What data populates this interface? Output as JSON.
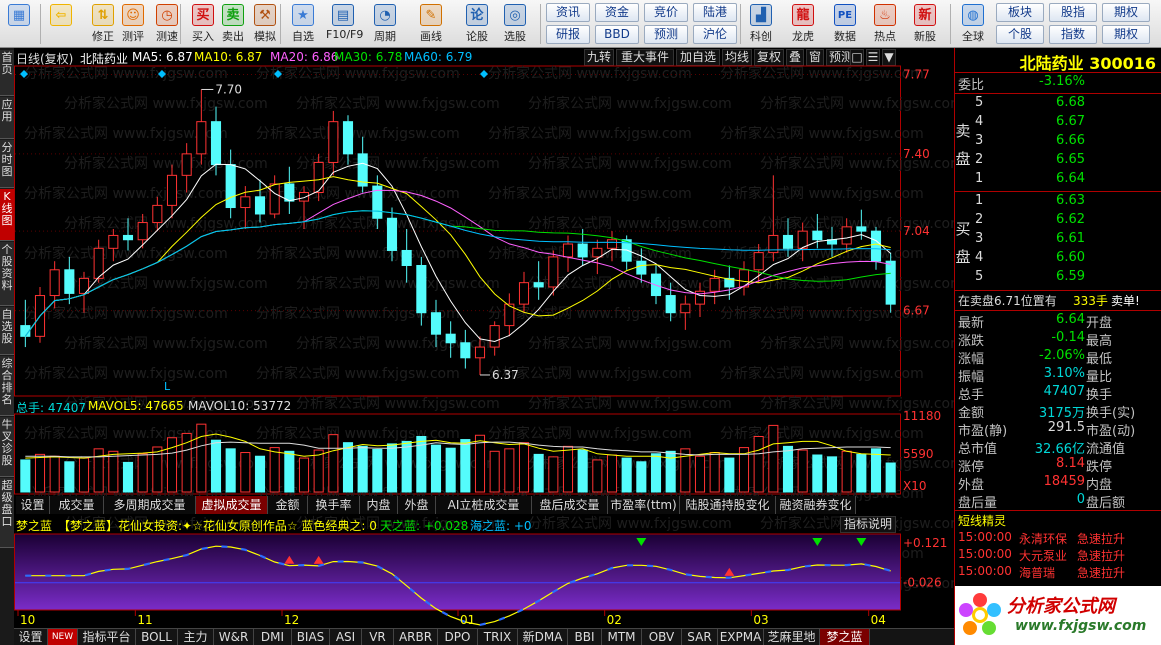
{
  "toolbar": {
    "main": [
      {
        "label": "",
        "icon": "windows-icon"
      },
      {
        "label": "",
        "icon": "back-arrow-icon"
      },
      {
        "label": "修正",
        "icon": "up-down-icon"
      },
      {
        "label": "测评",
        "icon": "face-icon"
      },
      {
        "label": "测速",
        "icon": "clock-icon"
      },
      {
        "label": "买入",
        "icon": "buy-icon",
        "glyph": "买"
      },
      {
        "label": "卖出",
        "icon": "sell-icon",
        "glyph": "卖"
      },
      {
        "label": "模拟",
        "icon": "hammer-icon"
      },
      {
        "label": "自选",
        "icon": "star-icon"
      },
      {
        "label": "F10/F9",
        "icon": "f10-icon"
      },
      {
        "label": "周期",
        "icon": "period-icon"
      },
      {
        "label": "画线",
        "icon": "pencil-icon"
      },
      {
        "label": "论股",
        "icon": "discuss-icon"
      },
      {
        "label": "选股",
        "icon": "screen-icon"
      }
    ],
    "grid": [
      {
        "top": "资讯",
        "bottom": "研报"
      },
      {
        "top": "资金",
        "bottom": "BBD"
      },
      {
        "top": "竞价",
        "bottom": "预测"
      },
      {
        "top": "陆港",
        "bottom": "沪伦"
      }
    ],
    "right": [
      {
        "label": "科创",
        "icon": "chart-icon"
      },
      {
        "label": "龙虎",
        "icon": "dragon-icon"
      },
      {
        "label": "数据",
        "icon": "pe-icon",
        "glyph": "PE"
      },
      {
        "label": "热点",
        "icon": "fire-icon"
      },
      {
        "label": "新股",
        "icon": "new-stock-icon"
      },
      {
        "label": "全球",
        "icon": "globe-icon"
      }
    ],
    "right_grid": [
      {
        "top": "板块",
        "bottom": "个股"
      },
      {
        "top": "股指",
        "bottom": "指数"
      },
      {
        "top": "期权",
        "bottom": "期权"
      }
    ]
  },
  "sidebar": [
    "首页",
    "应用",
    "分时图",
    "K线图",
    "个股资料",
    "自选股",
    "综合排名",
    "牛叉诊股",
    "超级盘口"
  ],
  "chart_header": {
    "period": "日线(复权)",
    "name": "北陆药业",
    "ma5": "MA5: 6.87",
    "ma10": "MA10: 6.87",
    "ma20": "MA20: 6.86",
    "ma30": "MA30: 6.78",
    "ma60": "MA60: 6.79",
    "buttons": [
      "九转",
      "重大事件",
      "加自选",
      "均线",
      "复权",
      "叠",
      "窗",
      "预测"
    ]
  },
  "price_axis": [
    "7.77",
    "7.40",
    "7.04",
    "6.67"
  ],
  "annotations": {
    "high": "7.70",
    "low": "6.37",
    "l_marker": "L"
  },
  "volume": {
    "total": "总手: 47407",
    "mavol5": "MAVOL5: 47665",
    "mavol10": "MAVOL10: 53772",
    "axis": [
      "11180",
      "5590",
      "X10"
    ]
  },
  "volume_tabs": [
    "设置",
    "成交量",
    "多周期成交量",
    "虚拟成交量",
    "金额",
    "换手率",
    "内盘",
    "外盘",
    "AI立桩成交量",
    "盘后成交量",
    "市盈率(ttm)",
    "陆股通持股变化",
    "融资融券变化"
  ],
  "indicator": {
    "name": "梦之蓝",
    "title": "【梦之蓝】花仙女投资:✦☆花仙女原创作品☆ 蓝色经典之: 0",
    "tian": "天之蓝: +0.028",
    "hai": "海之蓝: +0",
    "help": "指标说明",
    "axis": [
      "+0.121",
      "-0.026"
    ]
  },
  "dates": [
    "10",
    "11",
    "12",
    "01",
    "02",
    "03",
    "04"
  ],
  "watermark": "分析家公式网 www.fxjgsw.com",
  "bottom_tabs": [
    "设置",
    "NEW",
    "指标平台",
    "BOLL",
    "主力",
    "W&R",
    "DMI",
    "BIAS",
    "ASI",
    "VR",
    "ARBR",
    "DPO",
    "TRIX",
    "新DMA",
    "BBI",
    "MTM",
    "OBV",
    "SAR",
    "EXPMA",
    "芝麻里地量",
    "梦之蓝"
  ],
  "quote": {
    "title": "北陆药业 300016",
    "weibi_label": "委比",
    "weibi": "-3.16%",
    "sell_label": "卖盘",
    "buy_label": "买盘",
    "sells": [
      {
        "lvl": "5",
        "price": "6.68"
      },
      {
        "lvl": "4",
        "price": "6.67"
      },
      {
        "lvl": "3",
        "price": "6.66"
      },
      {
        "lvl": "2",
        "price": "6.65"
      },
      {
        "lvl": "1",
        "price": "6.64"
      }
    ],
    "buys": [
      {
        "lvl": "1",
        "price": "6.63"
      },
      {
        "lvl": "2",
        "price": "6.62"
      },
      {
        "lvl": "3",
        "price": "6.61"
      },
      {
        "lvl": "4",
        "price": "6.60"
      },
      {
        "lvl": "5",
        "price": "6.59"
      }
    ],
    "notice": "在卖盘6.71位置有",
    "notice_vol": "333手",
    "notice_tag": "卖单!",
    "stats": [
      {
        "l": "最新",
        "v": "6.64",
        "c": "g",
        "l2": "开盘",
        "v2": "",
        "c2": "w"
      },
      {
        "l": "涨跌",
        "v": "-0.14",
        "c": "g",
        "l2": "最高",
        "v2": "",
        "c2": "w"
      },
      {
        "l": "涨幅",
        "v": "-2.06%",
        "c": "g",
        "l2": "最低",
        "v2": "",
        "c2": "w"
      },
      {
        "l": "振幅",
        "v": "3.10%",
        "c": "c",
        "l2": "量比",
        "v2": "",
        "c2": "w"
      },
      {
        "l": "总手",
        "v": "47407",
        "c": "c",
        "l2": "换手",
        "v2": "",
        "c2": "w"
      },
      {
        "l": "金额",
        "v": "3175万",
        "c": "c",
        "l2": "换手(实)",
        "v2": "",
        "c2": "w"
      },
      {
        "l": "市盈(静)",
        "v": "291.5",
        "c": "w",
        "l2": "市盈(动)",
        "v2": "",
        "c2": "w"
      },
      {
        "l": "总市值",
        "v": "32.66亿",
        "c": "c",
        "l2": "流通值",
        "v2": "",
        "c2": "w"
      },
      {
        "l": "涨停",
        "v": "8.14",
        "c": "r",
        "l2": "跌停",
        "v2": "",
        "c2": "w"
      },
      {
        "l": "外盘",
        "v": "18459",
        "c": "r",
        "l2": "内盘",
        "v2": "",
        "c2": "w"
      },
      {
        "l": "盘后量",
        "v": "0",
        "c": "c",
        "l2": "盘后额",
        "v2": "",
        "c2": "w"
      }
    ],
    "sprite_title": "短线精灵",
    "sprites": [
      {
        "time": "15:00:00",
        "name": "永清环保",
        "event": "急速拉升"
      },
      {
        "time": "15:00:00",
        "name": "大元泵业",
        "event": "急速拉升"
      },
      {
        "time": "15:00:00",
        "name": "海普瑞",
        "event": "急速拉升"
      }
    ],
    "logo_cn": "分析家公式网",
    "logo_url": "www.fxjgsw.com"
  },
  "colors": {
    "up": "#ff3232",
    "down": "#54fcfc",
    "ma5": "#ffffff",
    "ma10": "#ffff00",
    "ma20": "#ff60ff",
    "ma30": "#00e000",
    "ma60": "#00bfff",
    "frame": "#b00000"
  },
  "chart_data": {
    "type": "candlestick",
    "ylim": [
      6.3,
      7.8
    ],
    "ma_labels": [
      "MA5",
      "MA10",
      "MA20",
      "MA30",
      "MA60"
    ],
    "ohlc": [
      [
        6.6,
        6.72,
        6.5,
        6.55
      ],
      [
        6.55,
        6.78,
        6.52,
        6.74
      ],
      [
        6.74,
        6.9,
        6.68,
        6.86
      ],
      [
        6.86,
        6.92,
        6.7,
        6.75
      ],
      [
        6.75,
        6.85,
        6.66,
        6.82
      ],
      [
        6.82,
        7.0,
        6.8,
        6.96
      ],
      [
        6.96,
        7.05,
        6.9,
        7.02
      ],
      [
        7.02,
        7.1,
        6.95,
        7.0
      ],
      [
        7.0,
        7.12,
        6.96,
        7.08
      ],
      [
        7.08,
        7.2,
        7.04,
        7.16
      ],
      [
        7.16,
        7.35,
        7.1,
        7.3
      ],
      [
        7.3,
        7.45,
        7.22,
        7.4
      ],
      [
        7.4,
        7.7,
        7.35,
        7.55
      ],
      [
        7.55,
        7.62,
        7.3,
        7.35
      ],
      [
        7.35,
        7.42,
        7.1,
        7.15
      ],
      [
        7.15,
        7.25,
        7.05,
        7.2
      ],
      [
        7.2,
        7.28,
        7.08,
        7.12
      ],
      [
        7.12,
        7.3,
        7.1,
        7.26
      ],
      [
        7.26,
        7.34,
        7.12,
        7.18
      ],
      [
        7.18,
        7.25,
        7.05,
        7.22
      ],
      [
        7.22,
        7.4,
        7.18,
        7.36
      ],
      [
        7.36,
        7.6,
        7.3,
        7.55
      ],
      [
        7.55,
        7.58,
        7.35,
        7.4
      ],
      [
        7.4,
        7.48,
        7.22,
        7.25
      ],
      [
        7.25,
        7.3,
        7.05,
        7.1
      ],
      [
        7.1,
        7.15,
        6.9,
        6.95
      ],
      [
        6.95,
        7.05,
        6.8,
        6.88
      ],
      [
        6.88,
        6.92,
        6.6,
        6.66
      ],
      [
        6.66,
        6.72,
        6.5,
        6.56
      ],
      [
        6.56,
        6.62,
        6.45,
        6.52
      ],
      [
        6.52,
        6.58,
        6.4,
        6.45
      ],
      [
        6.45,
        6.55,
        6.37,
        6.5
      ],
      [
        6.5,
        6.62,
        6.46,
        6.6
      ],
      [
        6.6,
        6.75,
        6.55,
        6.7
      ],
      [
        6.7,
        6.85,
        6.66,
        6.8
      ],
      [
        6.8,
        6.9,
        6.72,
        6.78
      ],
      [
        6.78,
        6.95,
        6.74,
        6.92
      ],
      [
        6.92,
        7.02,
        6.85,
        6.98
      ],
      [
        6.98,
        7.05,
        6.88,
        6.92
      ],
      [
        6.92,
        7.0,
        6.84,
        6.96
      ],
      [
        6.96,
        7.04,
        6.9,
        7.0
      ],
      [
        7.0,
        7.02,
        6.86,
        6.9
      ],
      [
        6.9,
        6.96,
        6.8,
        6.84
      ],
      [
        6.84,
        6.88,
        6.7,
        6.74
      ],
      [
        6.74,
        6.8,
        6.62,
        6.66
      ],
      [
        6.66,
        6.74,
        6.58,
        6.7
      ],
      [
        6.7,
        6.8,
        6.64,
        6.76
      ],
      [
        6.76,
        6.86,
        6.7,
        6.82
      ],
      [
        6.82,
        6.88,
        6.72,
        6.78
      ],
      [
        6.78,
        6.9,
        6.74,
        6.86
      ],
      [
        6.86,
        6.98,
        6.8,
        6.94
      ],
      [
        6.94,
        7.3,
        6.9,
        7.02
      ],
      [
        7.02,
        7.1,
        6.92,
        6.96
      ],
      [
        6.96,
        7.08,
        6.9,
        7.04
      ],
      [
        7.04,
        7.12,
        6.96,
        7.0
      ],
      [
        7.0,
        7.06,
        6.92,
        6.98
      ],
      [
        6.98,
        7.1,
        6.94,
        7.06
      ],
      [
        7.06,
        7.14,
        7.0,
        7.04
      ],
      [
        7.04,
        7.06,
        6.86,
        6.9
      ],
      [
        6.9,
        6.94,
        6.66,
        6.7
      ]
    ],
    "volume": [
      52,
      61,
      58,
      49,
      55,
      70,
      66,
      48,
      62,
      73,
      88,
      95,
      110,
      84,
      70,
      64,
      58,
      72,
      66,
      55,
      68,
      93,
      80,
      74,
      69,
      78,
      82,
      90,
      76,
      71,
      85,
      92,
      66,
      70,
      80,
      61,
      57,
      74,
      68,
      52,
      60,
      55,
      49,
      62,
      66,
      70,
      58,
      64,
      55,
      72,
      90,
      108,
      74,
      68,
      60,
      57,
      66,
      61,
      70,
      47
    ],
    "mavol5": [
      55,
      56,
      57,
      56,
      55,
      58,
      61,
      62,
      63,
      65,
      72,
      80,
      90,
      94,
      89,
      82,
      70,
      65,
      62,
      58,
      60,
      67,
      72,
      77,
      75,
      76,
      79,
      82,
      84,
      80,
      79,
      83,
      80,
      77,
      78,
      71,
      66,
      68,
      70,
      62,
      60,
      58,
      58,
      58,
      55,
      58,
      61,
      64,
      62,
      62,
      68,
      78,
      80,
      82,
      82,
      75,
      66,
      62,
      61,
      60
    ],
    "mavol10": [
      58,
      58,
      58,
      57,
      57,
      57,
      58,
      59,
      60,
      61,
      63,
      68,
      75,
      80,
      81,
      80,
      79,
      79,
      79,
      76,
      71,
      71,
      71,
      72,
      71,
      71,
      73,
      76,
      80,
      78,
      77,
      80,
      81,
      81,
      79,
      76,
      74,
      73,
      73,
      70,
      68,
      67,
      65,
      65,
      63,
      61,
      60,
      61,
      61,
      61,
      62,
      65,
      67,
      70,
      71,
      72,
      73,
      73,
      73,
      72
    ],
    "indicator_axis": [
      -0.026,
      0.121
    ]
  }
}
